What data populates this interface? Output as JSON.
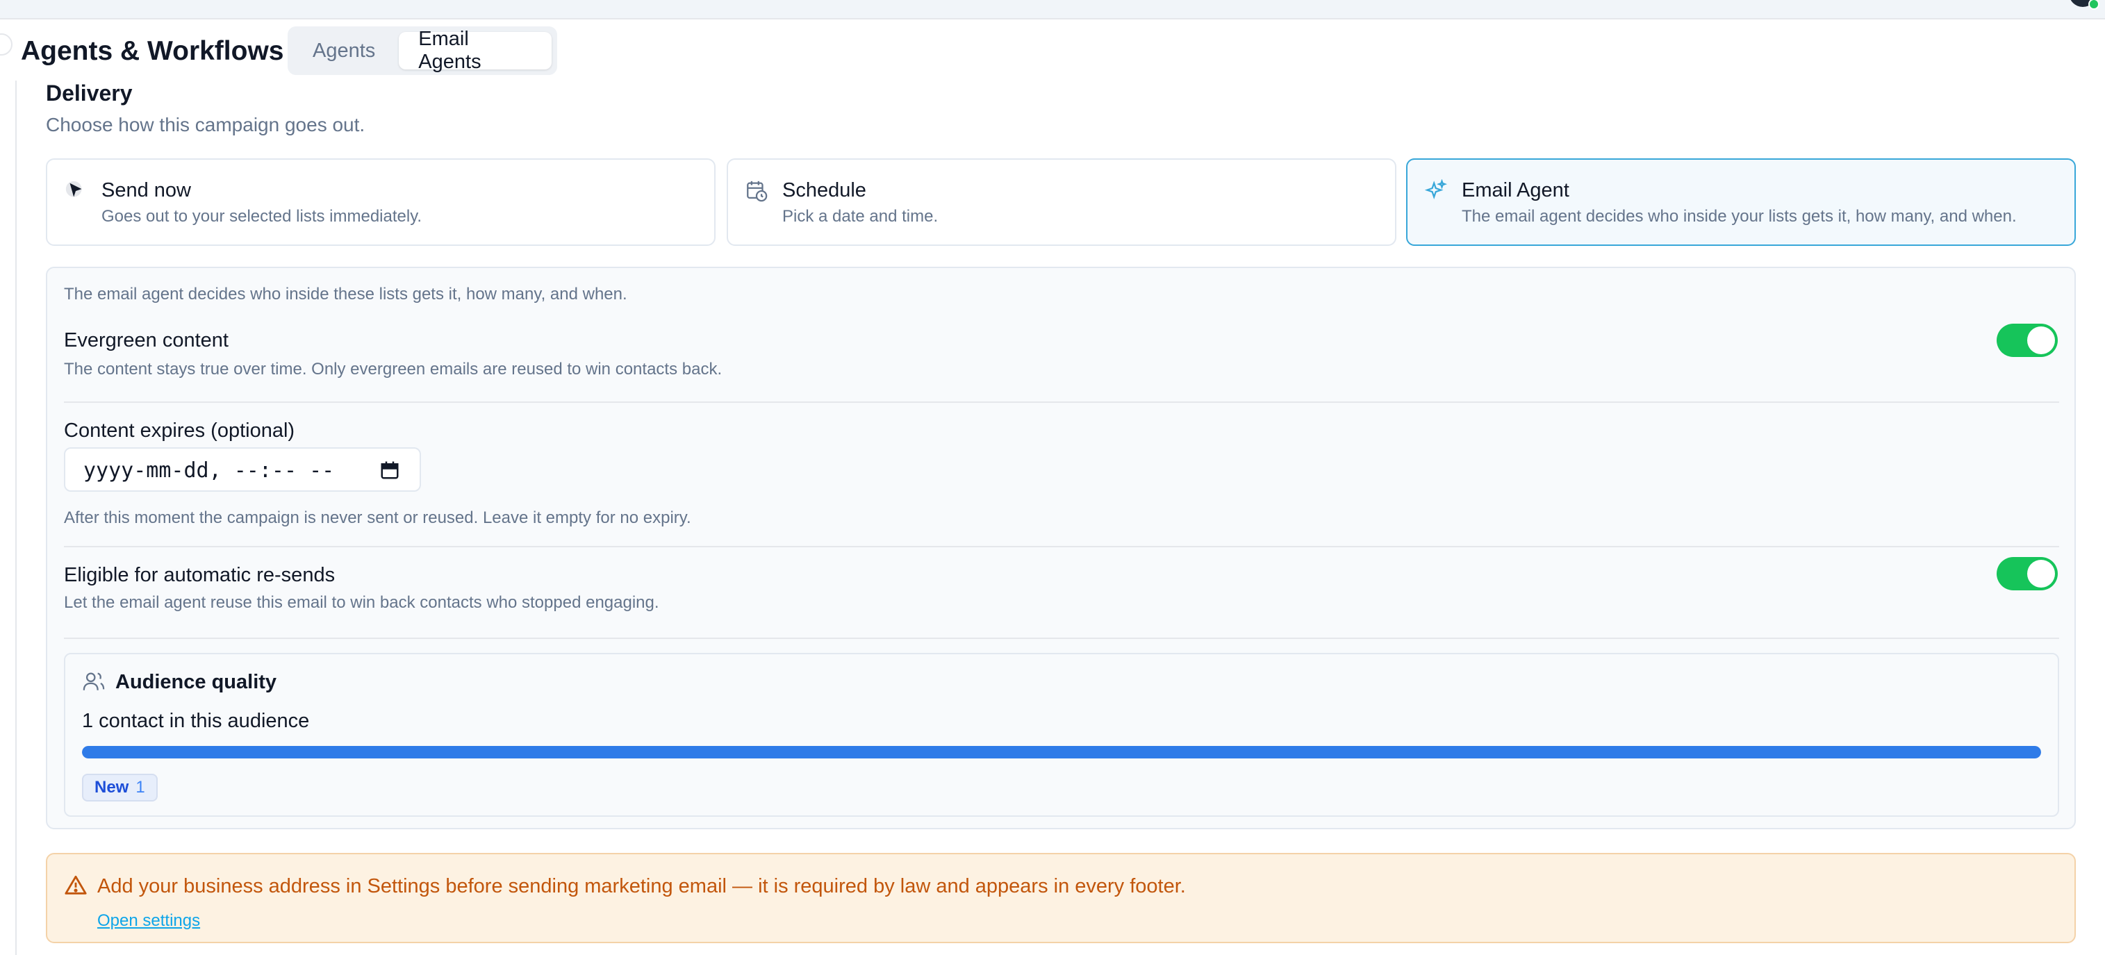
{
  "app": {
    "title": "Agents & Workflows",
    "tabs": [
      {
        "label": "Agents",
        "active": false
      },
      {
        "label": "Email Agents",
        "active": true
      }
    ]
  },
  "delivery": {
    "title": "Delivery",
    "subtitle": "Choose how this campaign goes out.",
    "options": [
      {
        "icon": "cursor-icon",
        "title": "Send now",
        "description": "Goes out to your selected lists immediately.",
        "selected": false
      },
      {
        "icon": "calendar-clock-icon",
        "title": "Schedule",
        "description": "Pick a date and time.",
        "selected": false
      },
      {
        "icon": "sparkles-icon",
        "title": "Email Agent",
        "description": "The email agent decides who inside your lists gets it, how many, and when.",
        "selected": true
      }
    ]
  },
  "agent_panel": {
    "intro": "The email agent decides who inside these lists gets it, how many, and when.",
    "evergreen": {
      "title": "Evergreen content",
      "description": "The content stays true over time. Only evergreen emails are reused to win contacts back.",
      "enabled": true
    },
    "expires": {
      "title": "Content expires (optional)",
      "placeholder": "yyyy-mm-dd, --:-- --",
      "help": "After this moment the campaign is never sent or reused. Leave it empty for no expiry."
    },
    "resends": {
      "title": "Eligible for automatic re-sends",
      "description": "Let the email agent reuse this email to win back contacts who stopped engaging.",
      "enabled": true
    },
    "audience": {
      "title": "Audience quality",
      "count_text": "1 contact in this audience",
      "progress": 1.0,
      "chips": [
        {
          "label": "New",
          "count": "1"
        }
      ]
    }
  },
  "warning": {
    "text": "Add your business address in Settings before sending marketing email — it is required by law and appears in every footer.",
    "link": "Open settings"
  },
  "colors": {
    "accent": "#38a7d9",
    "toggle_on": "#16c45a",
    "progress": "#2f7be8",
    "warning_text": "#c2560c"
  }
}
